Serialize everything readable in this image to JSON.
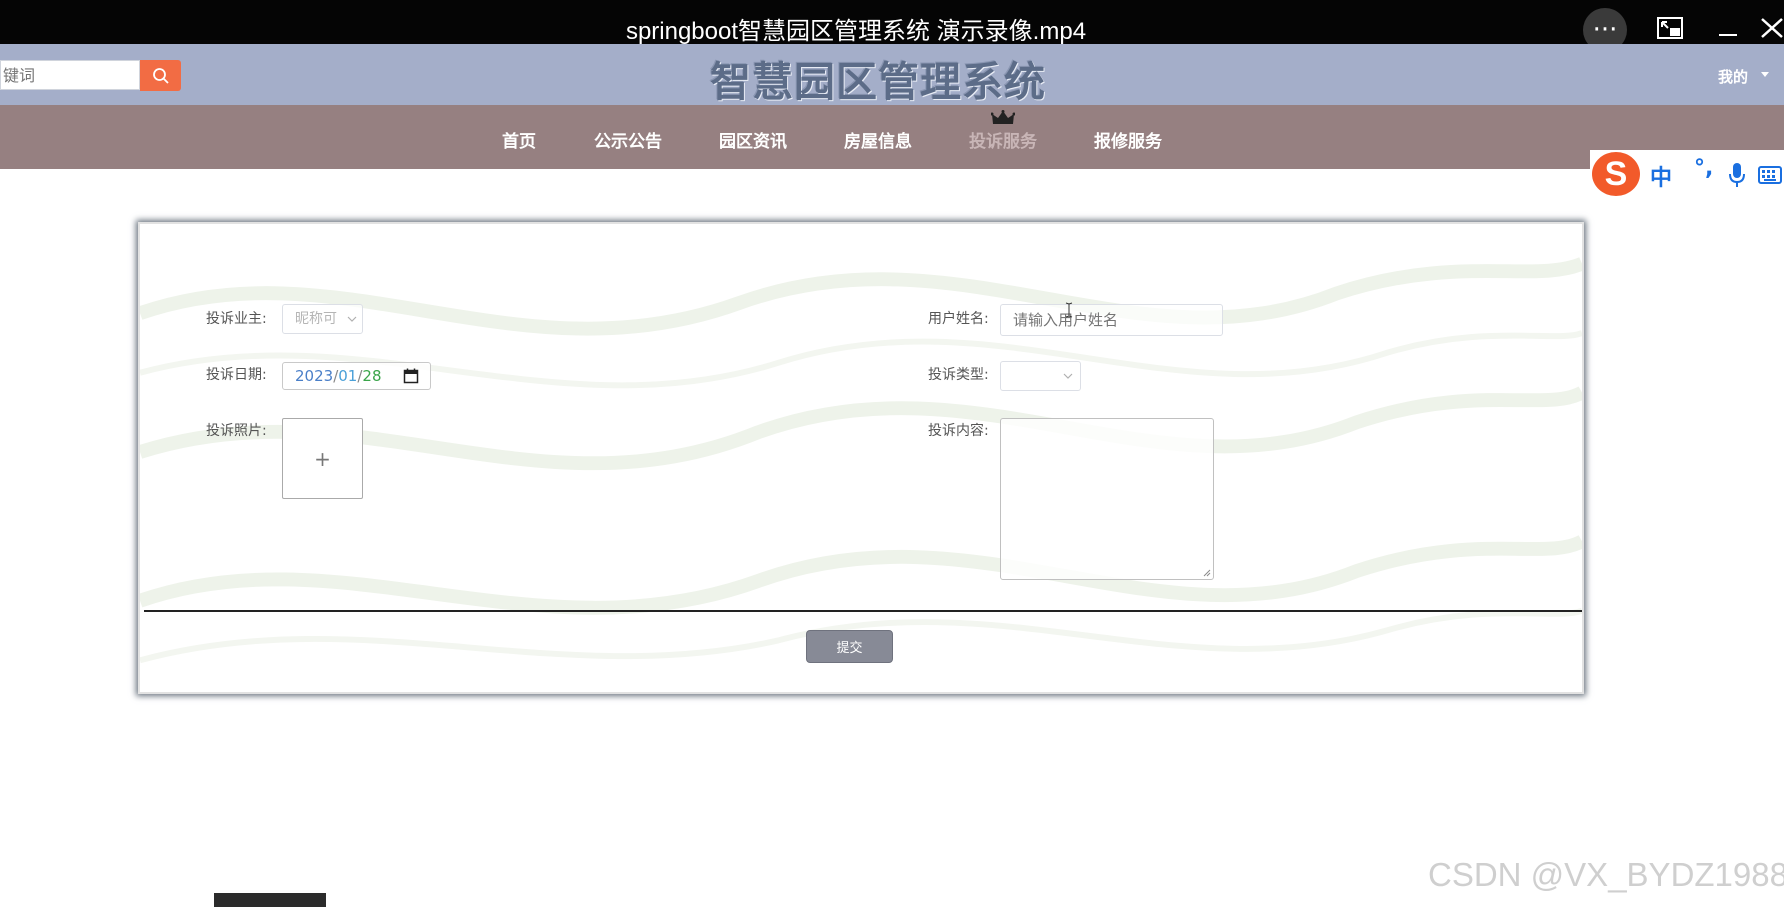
{
  "player": {
    "title": "springboot智慧园区管理系统 演示录像.mp4",
    "more_label": "···"
  },
  "header": {
    "search_placeholder": "键词",
    "site_title": "智慧园区管理系统",
    "user_menu_label": "我的"
  },
  "nav": {
    "items": [
      {
        "label": "首页"
      },
      {
        "label": "公示公告"
      },
      {
        "label": "园区资讯"
      },
      {
        "label": "房屋信息"
      },
      {
        "label": "投诉服务",
        "active": true
      },
      {
        "label": "报修服务"
      }
    ]
  },
  "ime": {
    "logo": "S",
    "mode": "中",
    "punct": "°,"
  },
  "form": {
    "owner_label": "投诉业主:",
    "owner_placeholder": "昵称可",
    "username_label": "用户姓名:",
    "username_placeholder": "请输入用户姓名",
    "date_label": "投诉日期:",
    "date_year": "2023",
    "date_month": "01",
    "date_day": "28",
    "date_sep": "/",
    "type_label": "投诉类型:",
    "photo_label": "投诉照片:",
    "upload_plus": "+",
    "content_label": "投诉内容:",
    "submit_label": "提交"
  },
  "watermark": "CSDN @VX_BYDZ1988",
  "colors": {
    "header_bg": "#a4aec9",
    "nav_bg": "#968081",
    "search_btn": "#f26c44",
    "submit_btn": "#878a96"
  }
}
